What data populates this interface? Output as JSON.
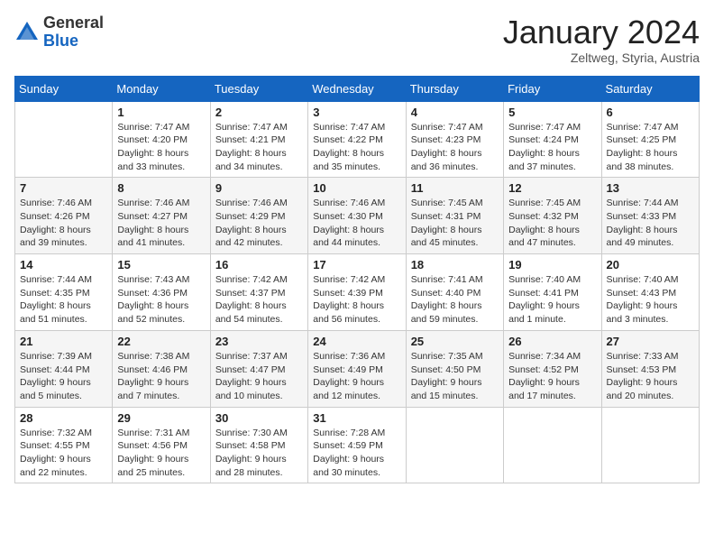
{
  "header": {
    "logo": {
      "general": "General",
      "blue": "Blue"
    },
    "title": "January 2024",
    "location": "Zeltweg, Styria, Austria"
  },
  "calendar": {
    "days_of_week": [
      "Sunday",
      "Monday",
      "Tuesday",
      "Wednesday",
      "Thursday",
      "Friday",
      "Saturday"
    ],
    "weeks": [
      [
        {
          "day": "",
          "info": ""
        },
        {
          "day": "1",
          "info": "Sunrise: 7:47 AM\nSunset: 4:20 PM\nDaylight: 8 hours\nand 33 minutes."
        },
        {
          "day": "2",
          "info": "Sunrise: 7:47 AM\nSunset: 4:21 PM\nDaylight: 8 hours\nand 34 minutes."
        },
        {
          "day": "3",
          "info": "Sunrise: 7:47 AM\nSunset: 4:22 PM\nDaylight: 8 hours\nand 35 minutes."
        },
        {
          "day": "4",
          "info": "Sunrise: 7:47 AM\nSunset: 4:23 PM\nDaylight: 8 hours\nand 36 minutes."
        },
        {
          "day": "5",
          "info": "Sunrise: 7:47 AM\nSunset: 4:24 PM\nDaylight: 8 hours\nand 37 minutes."
        },
        {
          "day": "6",
          "info": "Sunrise: 7:47 AM\nSunset: 4:25 PM\nDaylight: 8 hours\nand 38 minutes."
        }
      ],
      [
        {
          "day": "7",
          "info": "Sunrise: 7:46 AM\nSunset: 4:26 PM\nDaylight: 8 hours\nand 39 minutes."
        },
        {
          "day": "8",
          "info": "Sunrise: 7:46 AM\nSunset: 4:27 PM\nDaylight: 8 hours\nand 41 minutes."
        },
        {
          "day": "9",
          "info": "Sunrise: 7:46 AM\nSunset: 4:29 PM\nDaylight: 8 hours\nand 42 minutes."
        },
        {
          "day": "10",
          "info": "Sunrise: 7:46 AM\nSunset: 4:30 PM\nDaylight: 8 hours\nand 44 minutes."
        },
        {
          "day": "11",
          "info": "Sunrise: 7:45 AM\nSunset: 4:31 PM\nDaylight: 8 hours\nand 45 minutes."
        },
        {
          "day": "12",
          "info": "Sunrise: 7:45 AM\nSunset: 4:32 PM\nDaylight: 8 hours\nand 47 minutes."
        },
        {
          "day": "13",
          "info": "Sunrise: 7:44 AM\nSunset: 4:33 PM\nDaylight: 8 hours\nand 49 minutes."
        }
      ],
      [
        {
          "day": "14",
          "info": "Sunrise: 7:44 AM\nSunset: 4:35 PM\nDaylight: 8 hours\nand 51 minutes."
        },
        {
          "day": "15",
          "info": "Sunrise: 7:43 AM\nSunset: 4:36 PM\nDaylight: 8 hours\nand 52 minutes."
        },
        {
          "day": "16",
          "info": "Sunrise: 7:42 AM\nSunset: 4:37 PM\nDaylight: 8 hours\nand 54 minutes."
        },
        {
          "day": "17",
          "info": "Sunrise: 7:42 AM\nSunset: 4:39 PM\nDaylight: 8 hours\nand 56 minutes."
        },
        {
          "day": "18",
          "info": "Sunrise: 7:41 AM\nSunset: 4:40 PM\nDaylight: 8 hours\nand 59 minutes."
        },
        {
          "day": "19",
          "info": "Sunrise: 7:40 AM\nSunset: 4:41 PM\nDaylight: 9 hours\nand 1 minute."
        },
        {
          "day": "20",
          "info": "Sunrise: 7:40 AM\nSunset: 4:43 PM\nDaylight: 9 hours\nand 3 minutes."
        }
      ],
      [
        {
          "day": "21",
          "info": "Sunrise: 7:39 AM\nSunset: 4:44 PM\nDaylight: 9 hours\nand 5 minutes."
        },
        {
          "day": "22",
          "info": "Sunrise: 7:38 AM\nSunset: 4:46 PM\nDaylight: 9 hours\nand 7 minutes."
        },
        {
          "day": "23",
          "info": "Sunrise: 7:37 AM\nSunset: 4:47 PM\nDaylight: 9 hours\nand 10 minutes."
        },
        {
          "day": "24",
          "info": "Sunrise: 7:36 AM\nSunset: 4:49 PM\nDaylight: 9 hours\nand 12 minutes."
        },
        {
          "day": "25",
          "info": "Sunrise: 7:35 AM\nSunset: 4:50 PM\nDaylight: 9 hours\nand 15 minutes."
        },
        {
          "day": "26",
          "info": "Sunrise: 7:34 AM\nSunset: 4:52 PM\nDaylight: 9 hours\nand 17 minutes."
        },
        {
          "day": "27",
          "info": "Sunrise: 7:33 AM\nSunset: 4:53 PM\nDaylight: 9 hours\nand 20 minutes."
        }
      ],
      [
        {
          "day": "28",
          "info": "Sunrise: 7:32 AM\nSunset: 4:55 PM\nDaylight: 9 hours\nand 22 minutes."
        },
        {
          "day": "29",
          "info": "Sunrise: 7:31 AM\nSunset: 4:56 PM\nDaylight: 9 hours\nand 25 minutes."
        },
        {
          "day": "30",
          "info": "Sunrise: 7:30 AM\nSunset: 4:58 PM\nDaylight: 9 hours\nand 28 minutes."
        },
        {
          "day": "31",
          "info": "Sunrise: 7:28 AM\nSunset: 4:59 PM\nDaylight: 9 hours\nand 30 minutes."
        },
        {
          "day": "",
          "info": ""
        },
        {
          "day": "",
          "info": ""
        },
        {
          "day": "",
          "info": ""
        }
      ]
    ]
  }
}
